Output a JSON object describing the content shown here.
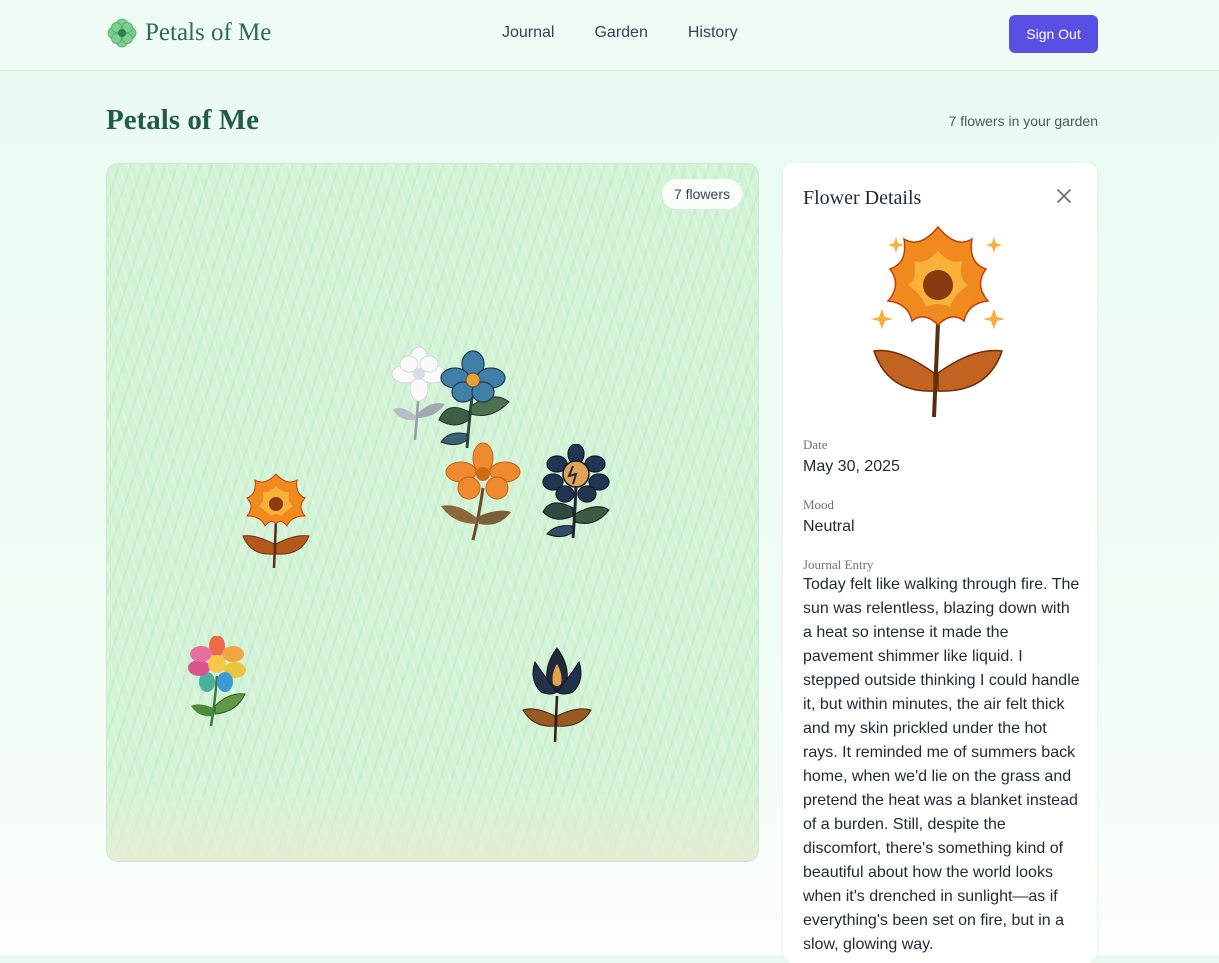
{
  "app": {
    "brand": "Petals of Me",
    "nav": [
      "Journal",
      "Garden",
      "History"
    ],
    "sign_out": "Sign Out",
    "accent_color": "#5a4fe4"
  },
  "page": {
    "title": "Petals of Me",
    "garden_count_text": "7 flowers in your garden"
  },
  "garden": {
    "badge": "7 flowers",
    "flowers": [
      {
        "icon": "white-flower-icon"
      },
      {
        "icon": "blue-flower-icon"
      },
      {
        "icon": "orange-flower-icon"
      },
      {
        "icon": "dark-blue-flower-icon"
      },
      {
        "icon": "fire-flower-icon"
      },
      {
        "icon": "rainbow-flower-icon"
      },
      {
        "icon": "dark-lotus-flower-icon"
      }
    ]
  },
  "details": {
    "title": "Flower Details",
    "selected_icon": "fire-flower-icon",
    "date_label": "Date",
    "date": "May 30, 2025",
    "mood_label": "Mood",
    "mood": "Neutral",
    "entry_label": "Journal Entry",
    "entry": "Today felt like walking through fire. The sun was relentless, blazing down with a heat so intense it made the pavement shimmer like liquid. I stepped outside thinking I could handle it, but within minutes, the air felt thick and my skin prickled under the hot rays. It reminded me of summers back home, when we'd lie on the grass and pretend the heat was a blanket instead of a burden. Still, despite the discomfort, there's something kind of beautiful about how the world looks when it's drenched in sunlight—as if everything's been set on fire, but in a slow, glowing way."
  }
}
